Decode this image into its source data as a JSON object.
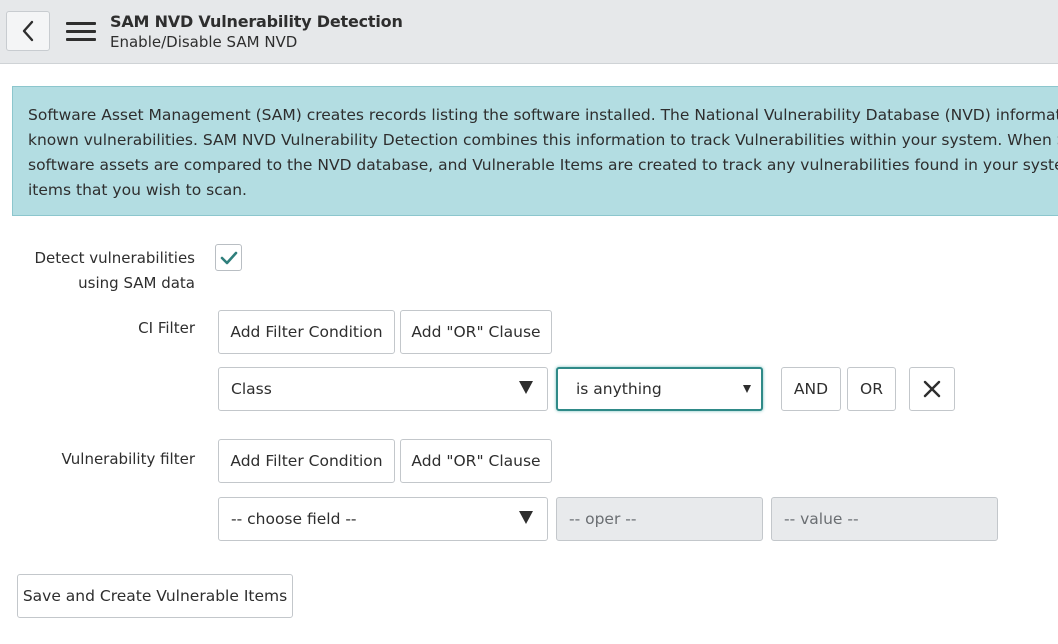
{
  "header": {
    "title": "SAM NVD Vulnerability Detection",
    "subtitle": "Enable/Disable SAM NVD"
  },
  "info": {
    "lines": [
      "Software Asset Management (SAM) creates records listing the software installed. The National Vulnerability Database (NVD) information indi",
      "known vulnerabilities. SAM NVD Vulnerability Detection combines this information to track Vulnerabilities within your system. When SAM NV",
      "software assets are compared to the NVD database, and Vulnerable Items are created to track any vulnerabilities found in your system. Use t",
      "items that you wish to scan."
    ]
  },
  "form": {
    "detect_label_line1": "Detect vulnerabilities",
    "detect_label_line2": "using SAM data",
    "detect_checked": true,
    "ci_filter": {
      "label": "CI Filter",
      "add_condition": "Add Filter Condition",
      "add_or": "Add \"OR\" Clause",
      "field": "Class",
      "operator": "is anything",
      "and_label": "AND",
      "or_label": "OR"
    },
    "vuln_filter": {
      "label": "Vulnerability filter",
      "add_condition": "Add Filter Condition",
      "add_or": "Add \"OR\" Clause",
      "field_placeholder": "-- choose field --",
      "oper_placeholder": "-- oper --",
      "value_placeholder": "-- value --"
    },
    "save_button": "Save and Create Vulnerable Items"
  },
  "icons": {
    "back": "chevron-left-icon",
    "menu": "hamburger-menu-icon",
    "check": "checkmark-icon",
    "remove": "close-icon"
  },
  "colors": {
    "info_background": "#b3dde2",
    "check_color": "#2f7f7c",
    "focus_border": "#2f8a88"
  }
}
